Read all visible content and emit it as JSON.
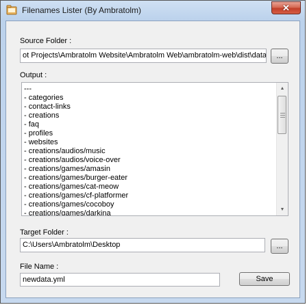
{
  "window": {
    "title": "Filenames Lister (By Ambratolm)",
    "close_glyph": "✕"
  },
  "source": {
    "label": "Source Folder :",
    "value": "ot Projects\\Ambratolm Website\\Ambratolm Web\\ambratolm-web\\dist\\data",
    "browse_label": "..."
  },
  "output": {
    "label": "Output :",
    "lines": [
      "---",
      "- categories",
      "- contact-links",
      "- creations",
      "- faq",
      "- profiles",
      "- websites",
      "- creations/audios/music",
      "- creations/audios/voice-over",
      "- creations/games/amasin",
      "- creations/games/burger-eater",
      "- creations/games/cat-meow",
      "- creations/games/cf-platformer",
      "- creations/games/cocoboy",
      "- creations/games/darkina"
    ],
    "scroll_up_glyph": "▲",
    "scroll_down_glyph": "▼"
  },
  "target": {
    "label": "Target Folder :",
    "value": "C:\\Users\\Ambratolm\\Desktop",
    "browse_label": "..."
  },
  "filename": {
    "label": "File Name :",
    "value": "newdata.yml",
    "save_label": "Save"
  }
}
